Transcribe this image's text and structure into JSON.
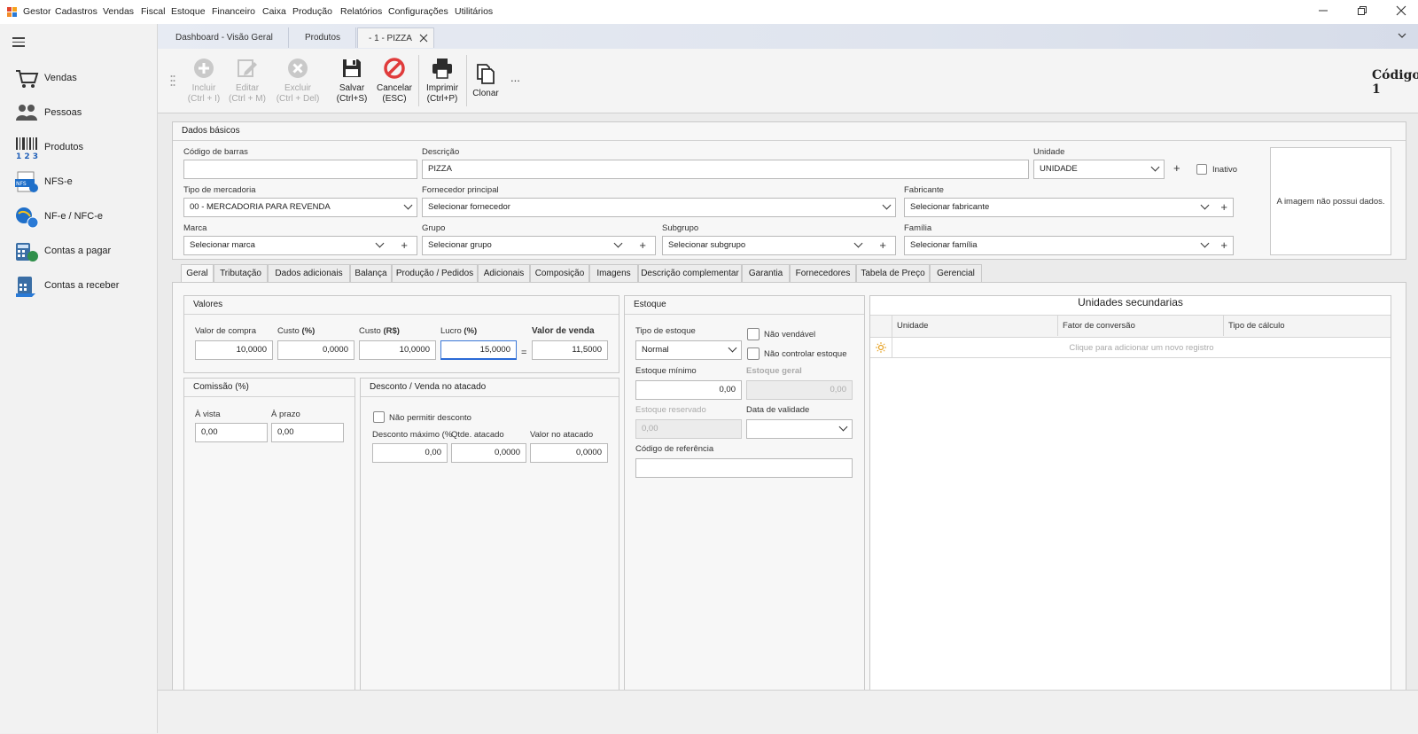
{
  "menu": {
    "app": "Gestor",
    "items": [
      "Cadastros",
      "Vendas",
      "Fiscal",
      "Estoque",
      "Financeiro",
      "Caixa",
      "Produção",
      "Relatórios",
      "Configurações",
      "Utilitários"
    ]
  },
  "window_controls": [
    "minimize-icon",
    "restore-icon",
    "close-icon"
  ],
  "sidebar": {
    "items": [
      {
        "label": "Vendas",
        "icon": "cart-icon"
      },
      {
        "label": "Pessoas",
        "icon": "people-icon"
      },
      {
        "label": "Produtos",
        "icon": "barcode-icon"
      },
      {
        "label": "NFS-e",
        "icon": "nfse-icon"
      },
      {
        "label": "NF-e / NFC-e",
        "icon": "nfe-icon"
      },
      {
        "label": "Contas a pagar",
        "icon": "calculator-icon"
      },
      {
        "label": "Contas a receber",
        "icon": "receivable-icon"
      }
    ]
  },
  "doc_tabs": [
    "Dashboard - Visão Geral",
    "Produtos",
    "- 1 - PIZZA"
  ],
  "toolbar": {
    "incluir": [
      "Incluir",
      "(Ctrl + I)"
    ],
    "editar": [
      "Editar",
      "(Ctrl + M)"
    ],
    "excluir": [
      "Excluir",
      "(Ctrl + Del)"
    ],
    "salvar": [
      "Salvar",
      "(Ctrl+S)"
    ],
    "cancelar": [
      "Cancelar",
      "(ESC)"
    ],
    "imprimir": [
      "Imprimir",
      "(Ctrl+P)"
    ],
    "clonar": "Clonar",
    "more": "...",
    "codigo_label": "Código",
    "codigo_value": "1"
  },
  "dados_basicos": {
    "title": "Dados básicos",
    "codigo_barras_label": "Código de barras",
    "codigo_barras_value": "",
    "descricao_label": "Descrição",
    "descricao_value": "PIZZA",
    "unidade_label": "Unidade",
    "unidade_value": "UNIDADE",
    "inativo_label": "Inativo",
    "tipo_mercadoria_label": "Tipo de mercadoria",
    "tipo_mercadoria_value": "00 - MERCADORIA PARA REVENDA",
    "fornecedor_label": "Fornecedor principal",
    "fornecedor_value": "Selecionar fornecedor",
    "fabricante_label": "Fabricante",
    "fabricante_value": "Selecionar fabricante",
    "marca_label": "Marca",
    "marca_value": "Selecionar marca",
    "grupo_label": "Grupo",
    "grupo_value": "Selecionar grupo",
    "subgrupo_label": "Subgrupo",
    "subgrupo_value": "Selecionar subgrupo",
    "familia_label": "Família",
    "familia_value": "Selecionar família",
    "imagem_text": "A imagem não possui dados."
  },
  "sub_tabs": [
    "Geral",
    "Tributação",
    "Dados adicionais",
    "Balança",
    "Produção / Pedidos",
    "Adicionais",
    "Composição",
    "Imagens",
    "Descrição complementar",
    "Garantia",
    "Fornecedores",
    "Tabela de Preço",
    "Gerencial"
  ],
  "valores": {
    "title": "Valores",
    "valor_compra_label": "Valor de compra",
    "valor_compra": "10,0000",
    "custo_pct_label": "Custo",
    "custo_pct_unit": "(%)",
    "custo_pct": "0,0000",
    "custo_rs_label": "Custo",
    "custo_rs_unit": "(R$)",
    "custo_rs": "10,0000",
    "lucro_label": "Lucro",
    "lucro_unit": "(%)",
    "lucro": "15,0000",
    "equals": "=",
    "valor_venda_label": "Valor de venda",
    "valor_venda": "11,5000"
  },
  "comissao": {
    "title": "Comissão (%)",
    "vista_label": "À vista",
    "vista": "0,00",
    "prazo_label": "À prazo",
    "prazo": "0,00"
  },
  "desconto": {
    "title": "Desconto / Venda no atacado",
    "nao_permitir_label": "Não permitir desconto",
    "desconto_max_label": "Desconto máximo (%",
    "desconto_max": "0,00",
    "qtde_label": "Qtde. atacado",
    "qtde": "0,0000",
    "valor_atacado_label": "Valor no atacado",
    "valor_atacado": "0,0000"
  },
  "estoque": {
    "title": "Estoque",
    "tipo_label": "Tipo de estoque",
    "tipo_value": "Normal",
    "nao_vendavel_label": "Não vendável",
    "nao_controlar_label": "Não controlar estoque",
    "minimo_label": "Estoque mínimo",
    "minimo": "0,00",
    "geral_label": "Estoque geral",
    "geral": "0,00",
    "reservado_label": "Estoque reservado",
    "reservado": "0,00",
    "validade_label": "Data de validade",
    "validade": "",
    "referencia_label": "Código de referência",
    "referencia": ""
  },
  "unidades": {
    "title": "Unidades secundarias",
    "columns": [
      "Unidade",
      "Fator de conversão",
      "Tipo de cálculo"
    ],
    "new_row_text": "Clique para adicionar um novo registro"
  },
  "colors": {
    "accent": "#2a6ad6",
    "cancel_red": "#e03b3b",
    "arrow_red": "#c0282d",
    "menu_orange": "#f28c28"
  }
}
